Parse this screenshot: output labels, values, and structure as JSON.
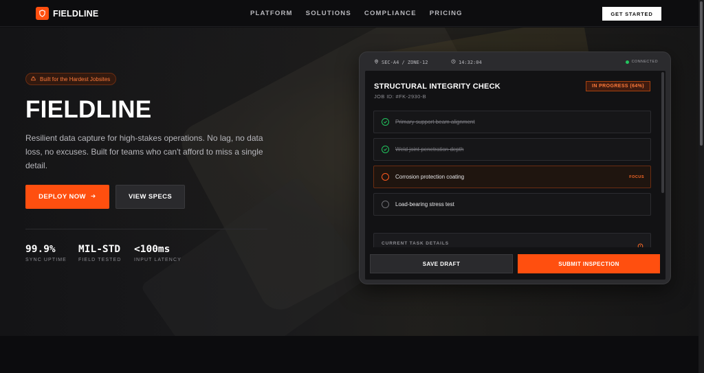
{
  "nav": {
    "brand": "FIELDLINE",
    "links": [
      "PLATFORM",
      "SOLUTIONS",
      "COMPLIANCE",
      "PRICING"
    ],
    "cta": "GET STARTED"
  },
  "hero": {
    "badge": "Built for the Hardest Jobsites",
    "title": "FIELDLINE",
    "description": "Resilient data capture for high-stakes operations. No lag, no data loss, no excuses. Built for teams who can't afford to miss a single detail.",
    "primary_cta": "DEPLOY NOW",
    "secondary_cta": "VIEW SPECS",
    "stats": [
      {
        "value": "99.9%",
        "label": "SYNC UPTIME"
      },
      {
        "value": "MIL-STD",
        "label": "FIELD TESTED"
      },
      {
        "value": "<100ms",
        "label": "INPUT LATENCY"
      }
    ]
  },
  "device": {
    "location": "SEC-A4 / ZONE-12",
    "time": "14:32:04",
    "connection": "CONNECTED",
    "check_title": "STRUCTURAL INTEGRITY CHECK",
    "job_id": "JOB ID: #FK-2930-B",
    "progress_label": "IN PROGRESS (64%)",
    "progress_percent": 64,
    "tasks": [
      {
        "label": "Primary support beam alignment",
        "state": "done",
        "tag": ""
      },
      {
        "label": "Weld joint penetration depth",
        "state": "done",
        "tag": ""
      },
      {
        "label": "Corrosion protection coating",
        "state": "current",
        "tag": "FOCUS"
      },
      {
        "label": "Load-bearing stress test",
        "state": "pending",
        "tag": ""
      }
    ],
    "details_label": "CURRENT TASK DETAILS",
    "save_label": "SAVE DRAFT",
    "submit_label": "SUBMIT INSPECTION"
  },
  "colors": {
    "accent": "#ff4f0f",
    "success": "#22c55e",
    "background": "#0e0e10"
  }
}
